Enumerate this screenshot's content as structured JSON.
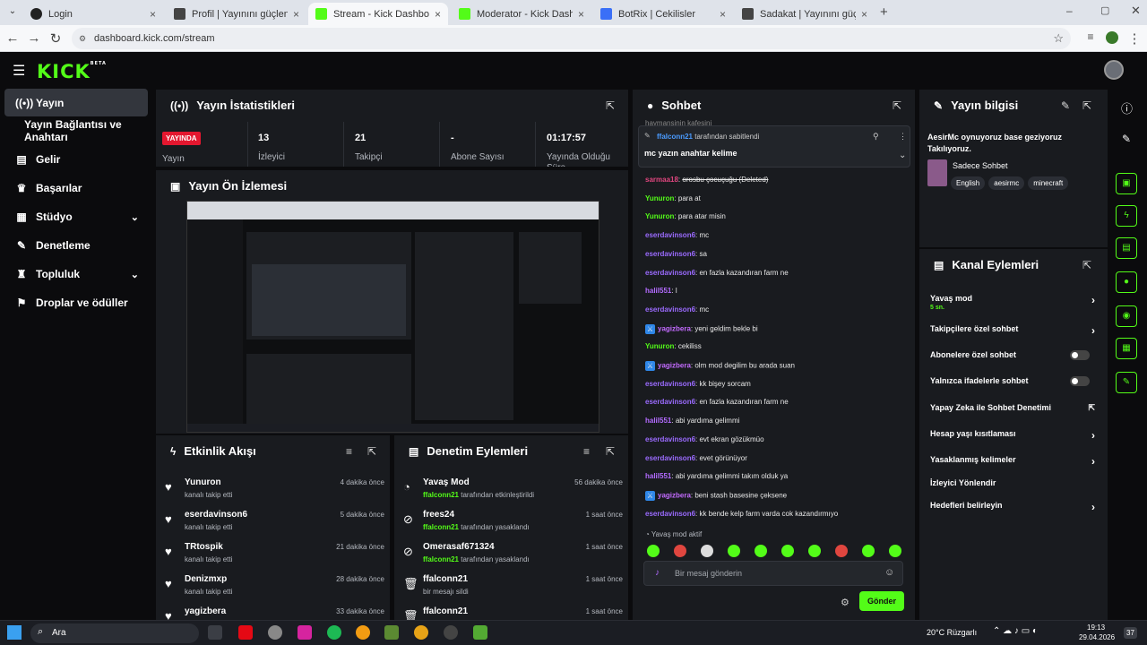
{
  "browser": {
    "tabs": [
      {
        "label": "Login",
        "favicon_color": "#222"
      },
      {
        "label": "Profil | Yayınını güçlendirmek i...",
        "favicon_color": "#444"
      },
      {
        "label": "Stream - Kick Dashboard",
        "favicon_color": "#53fc18"
      },
      {
        "label": "Moderator - Kick Dashboard",
        "favicon_color": "#53fc18"
      },
      {
        "label": "BotRix | Cekilisler",
        "favicon_color": "#3a6ff7"
      },
      {
        "label": "Sadakat | Yayınını güçlendirme...",
        "favicon_color": "#444"
      }
    ],
    "url": "dashboard.kick.com/stream"
  },
  "logo": "KICK",
  "logo_badge": "BETA",
  "sidebar": {
    "items": [
      {
        "label": "Yayın",
        "icon": "broadcast-icon"
      },
      {
        "label": "Yayın Bağlantısı ve Anahtarı",
        "icon": ""
      },
      {
        "label": "Gelir",
        "icon": "chart-icon"
      },
      {
        "label": "Başarılar",
        "icon": "trophy-icon"
      },
      {
        "label": "Stüdyo",
        "icon": "studio-icon"
      },
      {
        "label": "Denetleme",
        "icon": "wrench-icon"
      },
      {
        "label": "Topluluk",
        "icon": "community-icon"
      },
      {
        "label": "Droplar ve ödüller",
        "icon": "gift-icon"
      }
    ]
  },
  "stats": {
    "title": "Yayın İstatistikleri",
    "live_badge": "YAYINDA",
    "live_label": "Yayın",
    "viewers": {
      "value": "13",
      "label": "İzleyici"
    },
    "followers": {
      "value": "21",
      "label": "Takipçi"
    },
    "subs": {
      "value": "-",
      "label": "Abone Sayısı"
    },
    "uptime": {
      "value": "01:17:57",
      "label": "Yayında Olduğu Süre"
    }
  },
  "preview": {
    "title": "Yayın Ön İzlemesi"
  },
  "activity": {
    "title": "Etkinlik Akışı",
    "items": [
      {
        "name": "Yunuron",
        "sub": "kanalı takip etti",
        "time": "4 dakika önce"
      },
      {
        "name": "eserdavinson6",
        "sub": "kanalı takip etti",
        "time": "5 dakika önce"
      },
      {
        "name": "TRtospik",
        "sub": "kanalı takip etti",
        "time": "21 dakika önce"
      },
      {
        "name": "Denizmxp",
        "sub": "kanalı takip etti",
        "time": "28 dakika önce"
      },
      {
        "name": "yagizbera",
        "sub": "",
        "time": "33 dakika önce"
      }
    ]
  },
  "moderation": {
    "title": "Denetim Eylemleri",
    "items": [
      {
        "name": "Yavaş Mod",
        "actor": "ffalconn21",
        "sub": "tarafından etkinleştirildi",
        "time": "56 dakika önce"
      },
      {
        "name": "frees24",
        "actor": "ffalconn21",
        "sub": "tarafından yasaklandı",
        "time": "1 saat önce"
      },
      {
        "name": "Omerasaf671324",
        "actor": "ffalconn21",
        "sub": "tarafından yasaklandı",
        "time": "1 saat önce"
      },
      {
        "name": "ffalconn21",
        "actor": "",
        "sub": "bir mesajı sildi",
        "time": "1 saat önce"
      },
      {
        "name": "ffalconn21",
        "actor": "",
        "sub": "",
        "time": "1 saat önce"
      }
    ]
  },
  "chat": {
    "title": "Sohbet",
    "cut_top": "haymansinin kafesini",
    "pinned_by": "ffalconn21",
    "pinned_suffix": "tarafından sabitlendi",
    "pinned_text": "mc yazın anahtar kelime",
    "messages": [
      {
        "user": "sarmaa18",
        "color": "#e0467f",
        "text": "orosbu çocuçuğu (Deleted)",
        "badge": false
      },
      {
        "user": "Yunuron",
        "color": "#53fc18",
        "text": "para at",
        "badge": false
      },
      {
        "user": "Yunuron",
        "color": "#53fc18",
        "text": "para atar misin",
        "badge": false
      },
      {
        "user": "eserdavinson6",
        "color": "#9b6bff",
        "text": "mc",
        "badge": false
      },
      {
        "user": "eserdavinson6",
        "color": "#9b6bff",
        "text": "sa",
        "badge": false
      },
      {
        "user": "eserdavinson6",
        "color": "#9b6bff",
        "text": "en fazla kazandıran farm ne",
        "badge": false
      },
      {
        "user": "halil551",
        "color": "#b36bff",
        "text": "l",
        "badge": false
      },
      {
        "user": "eserdavinson6",
        "color": "#9b6bff",
        "text": "mc",
        "badge": false
      },
      {
        "user": "yagizbera",
        "color": "#c36bff",
        "text": "yeni geldim bekle bi",
        "badge": true
      },
      {
        "user": "Yunuron",
        "color": "#53fc18",
        "text": "cekiliss",
        "badge": false
      },
      {
        "user": "yagizbera",
        "color": "#c36bff",
        "text": "olm mod degilim bu arada suan",
        "badge": true
      },
      {
        "user": "eserdavinson6",
        "color": "#9b6bff",
        "text": "kk bişey sorcam",
        "badge": false
      },
      {
        "user": "eserdavinson6",
        "color": "#9b6bff",
        "text": "en fazla kazandıran farm ne",
        "badge": false
      },
      {
        "user": "halil551",
        "color": "#b36bff",
        "text": "abi yardıma gelimmi",
        "badge": false
      },
      {
        "user": "eserdavinson6",
        "color": "#9b6bff",
        "text": "evt ekran gözükmüo",
        "badge": false
      },
      {
        "user": "eserdavinson6",
        "color": "#9b6bff",
        "text": "evet görünüyor",
        "badge": false
      },
      {
        "user": "halil551",
        "color": "#b36bff",
        "text": "abi yardıma gelimmi takım olduk ya",
        "badge": false
      },
      {
        "user": "yagizbera",
        "color": "#c36bff",
        "text": "beni stash basesine çeksene",
        "badge": true
      },
      {
        "user": "eserdavinson6",
        "color": "#9b6bff",
        "text": "kk bende kelp farm varda cok kazandırmıyo",
        "badge": false
      }
    ],
    "slow_mode": "Yavaş mod aktif",
    "input_placeholder": "Bir mesaj gönderin",
    "send_label": "Gönder",
    "emotes": [
      "#53fc18",
      "#e0463f",
      "#dddddd",
      "#53fc18",
      "#53fc18",
      "#53fc18",
      "#53fc18",
      "#e0463f",
      "#53fc18",
      "#53fc18"
    ]
  },
  "info": {
    "title": "Yayın bilgisi",
    "stream_title": "AesirMc oynuyoruz base geziyoruz Takılıyoruz.",
    "category": "Sadece Sohbet",
    "tags": [
      "English",
      "aesirmc",
      "minecraft"
    ]
  },
  "actions": {
    "title": "Kanal Eylemleri",
    "items": [
      {
        "label": "Yavaş mod",
        "sub": "5 sn.",
        "control": "chevron"
      },
      {
        "label": "Takipçilere özel sohbet",
        "sub": "",
        "control": "chevron"
      },
      {
        "label": "Abonelere özel sohbet",
        "sub": "",
        "control": "toggle"
      },
      {
        "label": "Yalnızca ifadelerle sohbet",
        "sub": "",
        "control": "toggle"
      },
      {
        "label": "Yapay Zeka ile Sohbet Denetimi",
        "sub": "",
        "control": "external"
      },
      {
        "label": "Hesap yaşı kısıtlaması",
        "sub": "",
        "control": "chevron"
      },
      {
        "label": "Yasaklanmış kelimeler",
        "sub": "",
        "control": "chevron"
      },
      {
        "label": "İzleyici Yönlendir",
        "sub": "",
        "control": "none"
      },
      {
        "label": "Hedefleri belirleyin",
        "sub": "",
        "control": "chevron"
      }
    ]
  },
  "taskbar": {
    "search": "Ara",
    "weather": "20°C  Rüzgarlı",
    "time": "19:13",
    "date": "29.04.2026",
    "notif": "37"
  }
}
